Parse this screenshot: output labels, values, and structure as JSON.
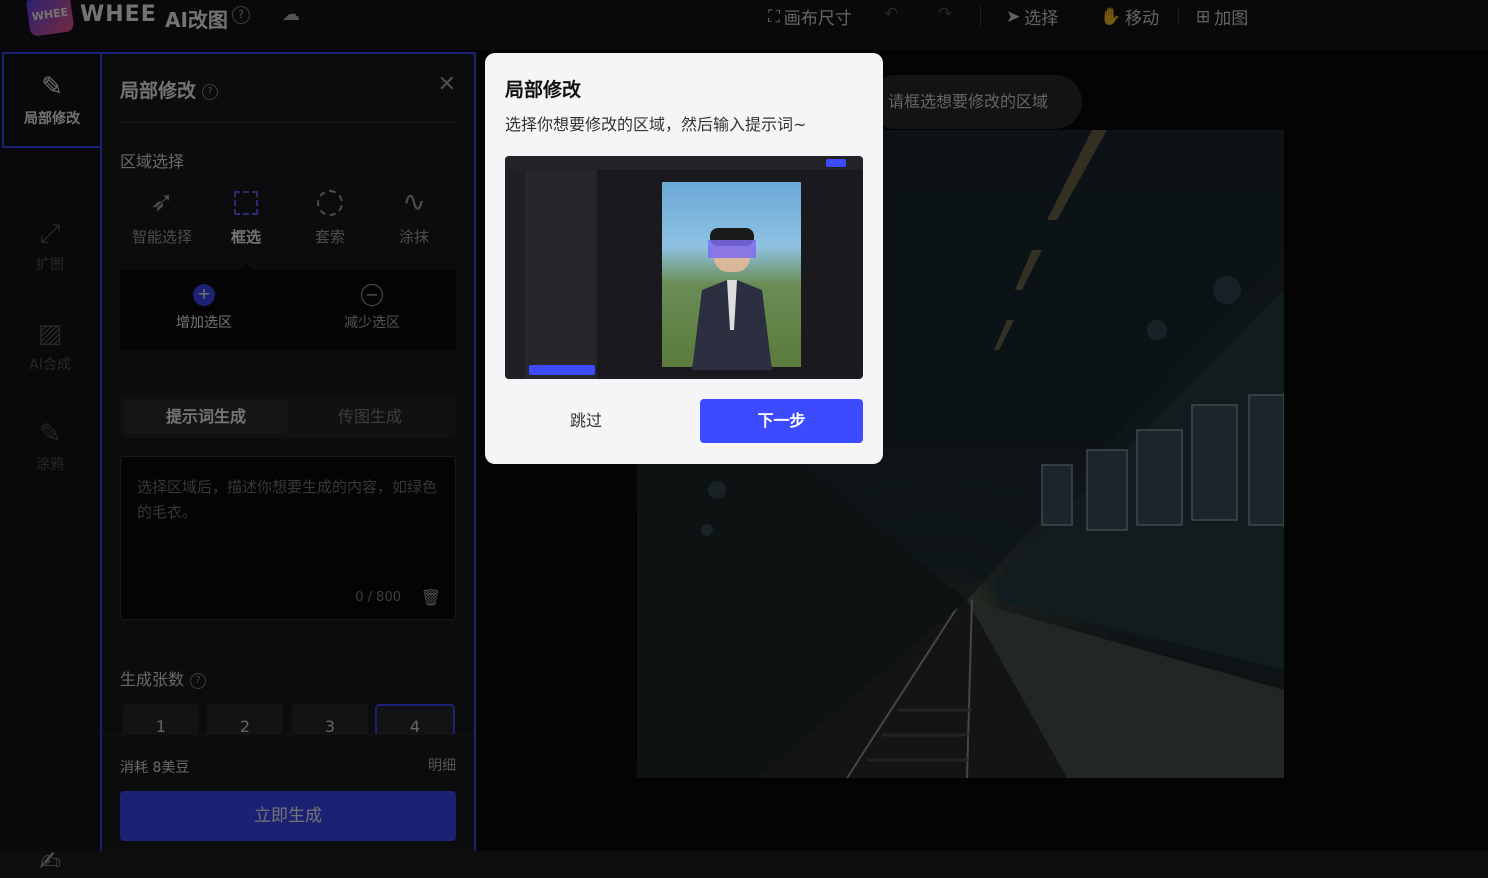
{
  "header": {
    "brand": "WHEE",
    "logo_text": "WHEE",
    "app_name": "AI改图",
    "toolbar": {
      "canvas_size": "画布尺寸",
      "select": "选择",
      "move": "移动",
      "add_image": "加图"
    }
  },
  "rail": {
    "items": [
      {
        "label": "局部修改",
        "icon": "edit-icon"
      },
      {
        "label": "扩图",
        "icon": "expand-icon"
      },
      {
        "label": "AI合成",
        "icon": "compose-icon"
      },
      {
        "label": "涂鸦",
        "icon": "brush-icon"
      }
    ]
  },
  "panel": {
    "title": "局部修改",
    "region_label": "区域选择",
    "tools": [
      {
        "label": "智能选择",
        "icon": "smart-select-icon"
      },
      {
        "label": "框选",
        "icon": "rect-select-icon",
        "active": true
      },
      {
        "label": "套索",
        "icon": "lasso-icon"
      },
      {
        "label": "涂抹",
        "icon": "smear-icon"
      }
    ],
    "selection_modes": {
      "add": "增加选区",
      "subtract": "减少选区"
    },
    "tabs": {
      "prompt": "提示词生成",
      "image": "传图生成"
    },
    "prompt_placeholder": "选择区域后，描述你想要生成的内容，如绿色的毛衣。",
    "counter": "0 / 800",
    "count_label": "生成张数",
    "counts": [
      "1",
      "2",
      "3",
      "4"
    ],
    "selected_count": "4",
    "cost": "消耗 8美豆",
    "detail": "明细",
    "generate": "立即生成"
  },
  "canvas": {
    "hint": "请框选想要修改的区域"
  },
  "popup": {
    "title": "局部修改",
    "description": "选择你想要修改的区域，然后输入提示词~",
    "skip": "跳过",
    "next": "下一步"
  },
  "colors": {
    "accent": "#3d4bff",
    "panel_bg": "#1c1c20",
    "popup_bg": "#f5f5f7"
  }
}
